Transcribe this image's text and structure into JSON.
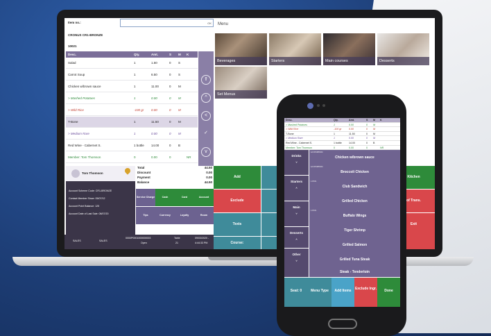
{
  "pos": {
    "item_no_label": "Item no.:",
    "ok_label": "OK",
    "store": "CRONUS CR1-BRONZE",
    "receipt_no": "10021",
    "columns": [
      "Desc.",
      "Qty.",
      "Amt.",
      "S",
      "M",
      "K"
    ],
    "lines": [
      {
        "desc": "Salad",
        "qty": "1",
        "amt": "1.50",
        "s": "0",
        "m": "S",
        "k": ""
      },
      {
        "desc": "Carrot Soup",
        "qty": "1",
        "amt": "6.50",
        "s": "0",
        "m": "S",
        "k": ""
      },
      {
        "desc": "Chicken w/brown sauce",
        "qty": "1",
        "amt": "11.00",
        "s": "0",
        "m": "M",
        "k": ""
      },
      {
        "desc": "> Mashed Potatoes",
        "qty": "1",
        "amt": "0.00",
        "s": "0",
        "m": "M",
        "k": ""
      },
      {
        "desc": "> Wild Rice",
        "qty": "-100 gr",
        "amt": "0.00",
        "s": "0",
        "m": "M",
        "k": ""
      },
      {
        "desc": "T-Bone",
        "qty": "1",
        "amt": "11.50",
        "s": "0",
        "m": "M",
        "k": ""
      },
      {
        "desc": "> Medium Rare",
        "qty": "1",
        "amt": "0.00",
        "s": "0",
        "m": "M",
        "k": ""
      },
      {
        "desc": "Red Wine - Cabernet S.",
        "qty": "1 bottle",
        "amt": "14.00",
        "s": "0",
        "m": "B",
        "k": ""
      },
      {
        "desc": "Member: Tom Thomson",
        "qty": "0",
        "amt": "0.00",
        "s": "0",
        "m": "",
        "k": "NR"
      }
    ],
    "customer": {
      "name": "Tom Thomson",
      "scheme": "Account Scheme Code: CR1-BRONZE",
      "since": "Contact Member Since: 05/07/12",
      "points": "Account Point Balance: 125",
      "last_sale": "Account Date of Last Sale: 08/07/20"
    },
    "totals": [
      {
        "label": "Total",
        "value": "44.50"
      },
      {
        "label": "Discount",
        "value": "0.00"
      },
      {
        "label": "Payment",
        "value": "0.00"
      },
      {
        "label": "Balance",
        "value": "44.50"
      }
    ],
    "payments": [
      "Service Charge",
      "Cash",
      "Card",
      "Account",
      "Tips",
      "Currency",
      "Loyalty",
      "Room"
    ],
    "status": {
      "a": "SALES",
      "b": "SALES",
      "c": "0000P0001000000003",
      "d": "Open",
      "e": "Table",
      "f": "21",
      "g": "09/03/2020 -",
      "h": "4:44:33 PM"
    }
  },
  "menu": {
    "title": "Menu",
    "tiles": [
      "Beverages",
      "Starters",
      "Main courses",
      "Desserts",
      "Set Menus"
    ],
    "functions": [
      "Add",
      "Exclude",
      "Texts",
      "Course:",
      "Kitchen",
      "of Trans.",
      "Exit"
    ]
  },
  "phone": {
    "columns": [
      "Desc.",
      "Qty.",
      "Amt.",
      "S",
      "M",
      "K"
    ],
    "lines": [
      {
        "desc": "> Mashed Potatoes",
        "qty": "1",
        "amt": "0.00",
        "s": "0",
        "m": "M",
        "k": ""
      },
      {
        "desc": "> Wild Rice",
        "qty": "-100 gr",
        "amt": "0.00",
        "s": "0",
        "m": "M",
        "k": ""
      },
      {
        "desc": "T-Bone",
        "qty": "1",
        "amt": "11.50",
        "s": "0",
        "m": "M",
        "k": ""
      },
      {
        "desc": "> Medium Rare",
        "qty": "1",
        "amt": "0.00",
        "s": "0",
        "m": "M",
        "k": ""
      },
      {
        "desc": "Red Wine - Cabernet S.",
        "qty": "1 bottle",
        "amt": "14.00",
        "s": "0",
        "m": "B",
        "k": ""
      },
      {
        "desc": "Member: Tom Thomson",
        "qty": "0",
        "amt": "0.00",
        "s": "0",
        "m": "",
        "k": "NR"
      }
    ],
    "categories": [
      "Drinks",
      "Starters",
      "Main",
      "Desserts",
      "Other"
    ],
    "items": [
      {
        "tag": "1/2 PORTION",
        "name": "Chicken w/brown sauce"
      },
      {
        "tag": "1/2 PORTION",
        "name": "Broccoli Chicken"
      },
      {
        "tag": "1 PCS",
        "name": "Club Sandwich"
      },
      {
        "tag": "",
        "name": "Grilled Chicken"
      },
      {
        "tag": "1 PCS",
        "name": "Buffalo Wings"
      },
      {
        "tag": "",
        "name": "Tiger Shrimp"
      },
      {
        "tag": "",
        "name": "Grilled Salmon"
      },
      {
        "tag": "",
        "name": "Grilled Tuna Steak"
      },
      {
        "tag": "",
        "name": "Steak - Tenderloin"
      }
    ],
    "buttons": [
      "Seat: 0",
      "Menu Type",
      "Add Items",
      "Exclude Ingr.",
      "Done"
    ]
  },
  "colors": {
    "purple": "#7b6e99",
    "dark": "#3b3548",
    "green": "#2e8b3a",
    "red": "#d9474b",
    "teal": "#3f8b9a"
  }
}
